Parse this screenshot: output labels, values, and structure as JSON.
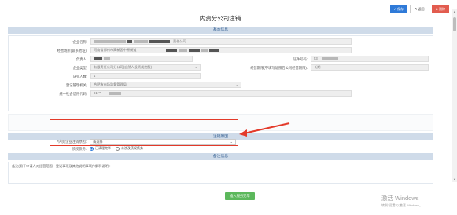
{
  "toolbar": {
    "save_label": "✔ 保存",
    "back_label": "↰ 返回",
    "delete_label": "⊗ 删除"
  },
  "page_title": "内资分公司注销",
  "sections": {
    "basic": "基本信息",
    "cancel": "注销原因",
    "remark": "备注信息"
  },
  "basic_info": {
    "company_name_label": "*企业名称:",
    "company_name_value": "责任公司",
    "address_label": "经营场所(联系地址):",
    "address_value": "河南省郑州市高新区中原街道",
    "person_label": "负责人:",
    "cert_no_label": "证件号码:",
    "cert_no_value": "53",
    "type_label": "企业类型:",
    "type_value": "有限责任公司分公司(自然人投资或控股)",
    "term_label": "经营期限(不填写证照后公司经营期限):",
    "term_value": "长期",
    "employees_label": "从业人数:",
    "employees_value": "1",
    "registry_label": "登记管理机关:",
    "registry_value": "合肥市市场监督管理局",
    "credit_code_label": "统一社会信用代码:",
    "credit_code_value": "91***"
  },
  "cancel_info": {
    "reason_label": "*内资企业注销原因:",
    "reason_value": "请选择",
    "debt_label": "债权债务:",
    "radio_1": "已清理完毕",
    "radio_2": "未涉及债权债务"
  },
  "remark": {
    "label": "备注(用于申请人对经营范围、登记事项及其他说明事项作解释说明):"
  },
  "bottom_button": "插入服务完毕",
  "watermark": {
    "line1": "激活 Windows",
    "line2": "转到\"设置\"以激活 Windows。"
  },
  "colors": {
    "accent": "#2f7ad8",
    "danger": "#e25c4f",
    "success": "#5cb85c",
    "highlight": "#e33a2a",
    "section_bg": "#cfdbe9"
  }
}
